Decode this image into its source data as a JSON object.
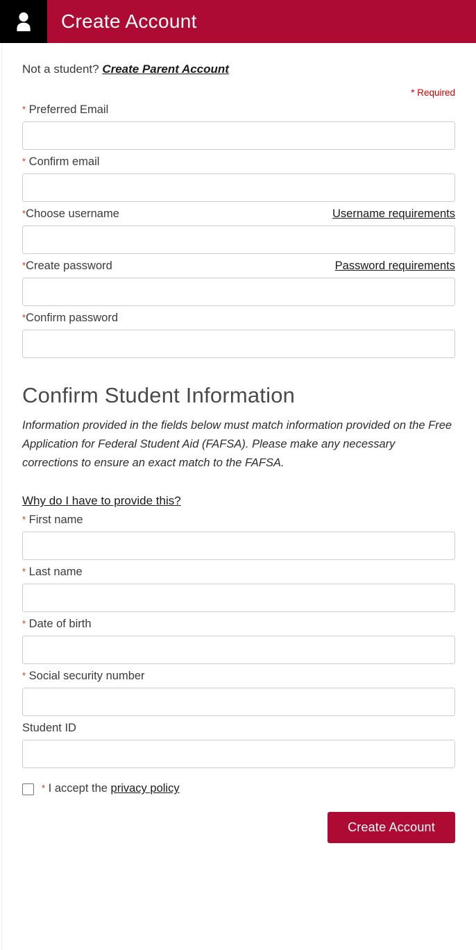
{
  "header": {
    "title": "Create Account",
    "icon": "person-icon",
    "bar_color": "#AD0B33",
    "icon_box_color": "#000000"
  },
  "intro": {
    "prefix": "Not a student? ",
    "link_label": "Create Parent Account"
  },
  "required_note": "* Required",
  "account_fields": [
    {
      "label": "Preferred Email",
      "required": true,
      "star_spacing": " ",
      "value": "",
      "placeholder": "",
      "link": null
    },
    {
      "label": "Confirm email",
      "required": true,
      "star_spacing": " ",
      "value": "",
      "placeholder": "",
      "link": null
    },
    {
      "label": "Choose username",
      "required": true,
      "star_spacing": "",
      "value": "",
      "placeholder": "",
      "link": "Username requirements"
    },
    {
      "label": "Create password",
      "required": true,
      "star_spacing": "",
      "value": "",
      "placeholder": "",
      "link": "Password requirements"
    },
    {
      "label": "Confirm password",
      "required": true,
      "star_spacing": "",
      "value": "",
      "placeholder": "",
      "link": null
    }
  ],
  "section": {
    "title": "Confirm Student Information",
    "description": "Information provided in the fields below must match information provided on the Free Application for Federal Student Aid (FAFSA). Please make any necessary corrections to ensure an exact match to the FAFSA.",
    "why_link": "Why do I have to provide this?"
  },
  "student_fields": [
    {
      "label": "First name",
      "required": true,
      "star_spacing": " ",
      "value": "",
      "placeholder": "",
      "link": null
    },
    {
      "label": "Last name",
      "required": true,
      "star_spacing": " ",
      "value": "",
      "placeholder": "",
      "link": null
    },
    {
      "label": "Date of birth",
      "required": true,
      "star_spacing": " ",
      "value": "",
      "placeholder": "",
      "link": null
    },
    {
      "label": "Social security number",
      "required": true,
      "star_spacing": " ",
      "value": "",
      "placeholder": "",
      "link": null
    },
    {
      "label": "Student ID",
      "required": false,
      "star_spacing": "",
      "value": "",
      "placeholder": "",
      "link": null
    }
  ],
  "accept": {
    "checked": false,
    "star": "*",
    "text": "I accept the ",
    "link_label": "privacy policy"
  },
  "submit": {
    "label": "Create Account",
    "color": "#AD0B33"
  },
  "colors": {
    "brand_crimson": "#AD0B33",
    "required_red": "#CC0000",
    "star_red": "#E03010",
    "input_border": "#CCCCCC",
    "label_text": "#3B3B3B"
  }
}
